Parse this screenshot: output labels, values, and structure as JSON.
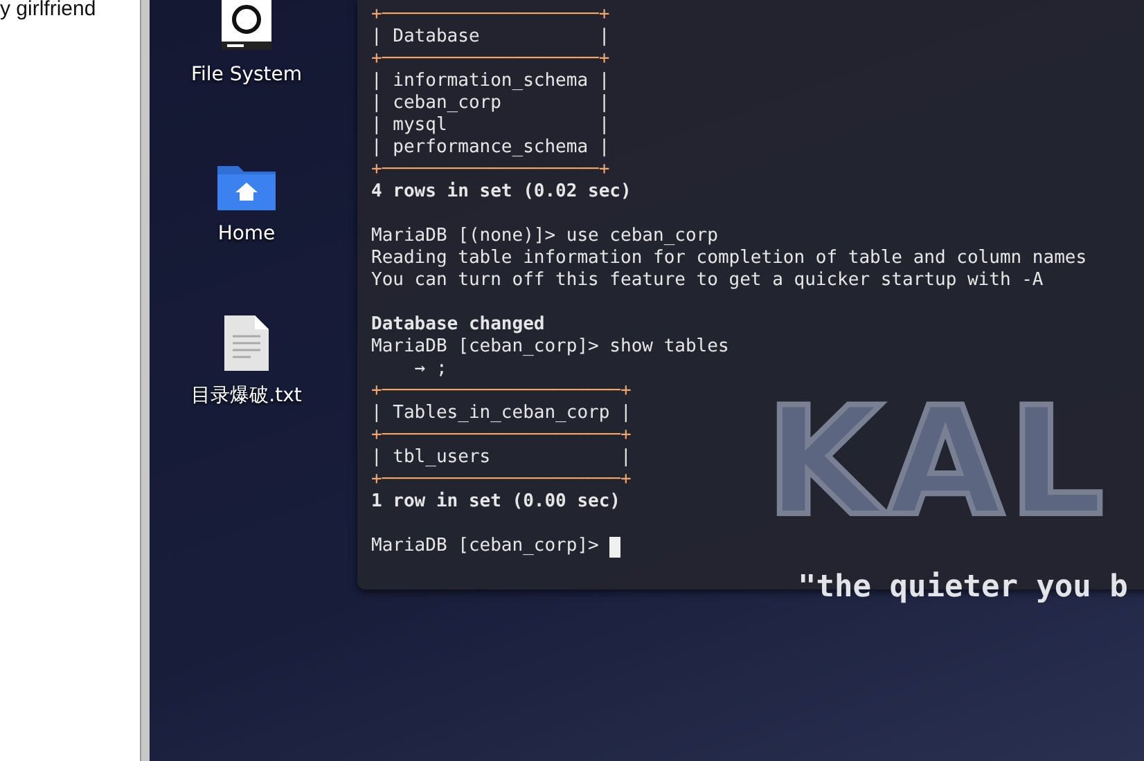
{
  "side_panel": {
    "text": "y girlfriend"
  },
  "desktop_icons": [
    {
      "label": "File System",
      "kind": "drive"
    },
    {
      "label": "Home",
      "kind": "home"
    },
    {
      "label": "目录爆破.txt",
      "kind": "textfile"
    }
  ],
  "wallpaper": {
    "logo": "KAL",
    "tagline": "\"the quieter you b"
  },
  "terminal": {
    "lines": [
      {
        "kind": "border",
        "text": "+────────────────────+"
      },
      {
        "kind": "row",
        "text": "| Database           |"
      },
      {
        "kind": "border",
        "text": "+────────────────────+"
      },
      {
        "kind": "row",
        "text": "| information_schema |"
      },
      {
        "kind": "row",
        "text": "| ceban_corp         |"
      },
      {
        "kind": "row",
        "text": "| mysql              |"
      },
      {
        "kind": "row",
        "text": "| performance_schema |"
      },
      {
        "kind": "border",
        "text": "+────────────────────+"
      },
      {
        "kind": "bold",
        "text": "4 rows in set (0.02 sec)"
      },
      {
        "kind": "blank"
      },
      {
        "kind": "plain",
        "text": "MariaDB [(none)]> use ceban_corp"
      },
      {
        "kind": "plain",
        "text": "Reading table information for completion of table and column names"
      },
      {
        "kind": "plain",
        "text": "You can turn off this feature to get a quicker startup with -A"
      },
      {
        "kind": "blank"
      },
      {
        "kind": "bold",
        "text": "Database changed"
      },
      {
        "kind": "plain",
        "text": "MariaDB [ceban_corp]> show tables"
      },
      {
        "kind": "plain",
        "text": "    → ;"
      },
      {
        "kind": "border",
        "text": "+──────────────────────+"
      },
      {
        "kind": "row",
        "text": "| Tables_in_ceban_corp |"
      },
      {
        "kind": "border",
        "text": "+──────────────────────+"
      },
      {
        "kind": "row",
        "text": "| tbl_users            |"
      },
      {
        "kind": "border",
        "text": "+──────────────────────+"
      },
      {
        "kind": "bold",
        "text": "1 row in set (0.00 sec)"
      },
      {
        "kind": "blank"
      },
      {
        "kind": "prompt",
        "text": "MariaDB [ceban_corp]> "
      }
    ]
  }
}
